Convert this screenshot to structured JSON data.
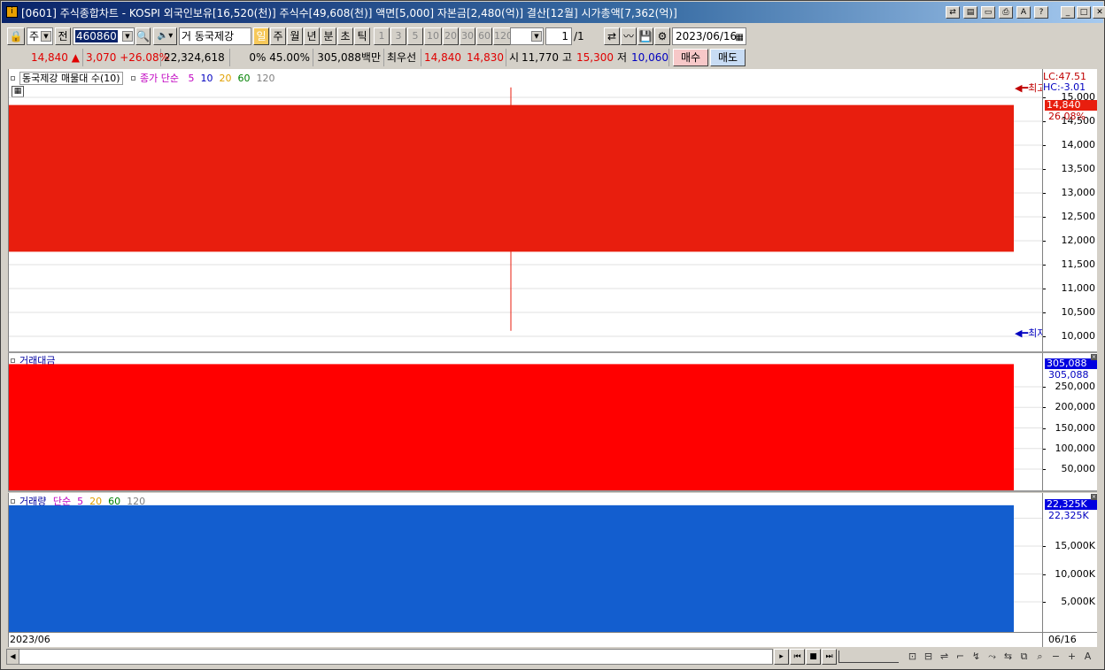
{
  "titlebar": {
    "icon": "app-icon",
    "text": "[0601] 주식종합차트 - KOSPI 외국인보유[16,520(천)] 주식수[49,608(천)] 액면[5,000] 자본금[2,480(억)] 결산[12월] 시가총액[7,362(억)]",
    "buttons": [
      "link-icon",
      "clipboard-icon",
      "window-icon",
      "print-icon",
      "font-icon",
      "help-icon",
      "minimize-icon",
      "maximize-icon",
      "close-icon"
    ],
    "button_glyphs": [
      "⇄",
      "▤",
      "▭",
      "⎙",
      "A",
      "?",
      "_",
      "□",
      "✕"
    ]
  },
  "toolbar": {
    "market": "주",
    "prev_label": "전",
    "code": "460860",
    "name_prefix": "거",
    "stock_name": "동국제강",
    "periods": [
      "일",
      "주",
      "월",
      "년",
      "분",
      "초",
      "틱"
    ],
    "minutes": [
      "1",
      "3",
      "5",
      "10",
      "20",
      "30",
      "60",
      "120"
    ],
    "page_current": "1",
    "page_total": "/1",
    "date": "2023/06/16"
  },
  "quote": {
    "price": "14,840",
    "change": "3,070",
    "change_pct": "+26.08%",
    "volume": "22,324,618",
    "ratio": "0% 45.00%",
    "amount": "305,088백만",
    "best_label": "최우선",
    "best_ask": "14,840",
    "best_bid": "14,830",
    "open_label": "시",
    "open": "11,770",
    "high_label": "고",
    "high": "15,300",
    "low_label": "저",
    "low": "10,060",
    "buy_label": "매수",
    "sell_label": "매도"
  },
  "price_panel": {
    "legend_title": "동국제강 매물대 수(10)",
    "ma_label": "종가 단순",
    "ma_periods": [
      "5",
      "10",
      "20",
      "60",
      "120"
    ],
    "ma_colors": [
      "#c000c0",
      "#0000c0",
      "#e0a000",
      "#008000",
      "#808080"
    ],
    "lc": "LC:47.51",
    "hc": "HC:-3.01",
    "current_price": "14,840",
    "current_pct": "26.08%",
    "high_marker": "최고",
    "low_marker": "최저",
    "ticks": [
      "15,000",
      "14,500",
      "14,000",
      "13,500",
      "13,000",
      "12,500",
      "12,000",
      "11,500",
      "11,000",
      "10,500",
      "10,000"
    ]
  },
  "amount_panel": {
    "legend_title": "거래대금",
    "current": "305,088",
    "current2": "305,088",
    "ticks": [
      "250,000",
      "200,000",
      "150,000",
      "100,000",
      "50,000"
    ]
  },
  "volume_panel": {
    "legend_title": "거래량",
    "ma_label": "단순",
    "ma_periods": [
      "5",
      "20",
      "60",
      "120"
    ],
    "ma_colors": [
      "#c000c0",
      "#e0a000",
      "#008000",
      "#808080"
    ],
    "current": "22,325K",
    "current2": "22,325K",
    "ticks": [
      "15,000K",
      "10,000K",
      "5,000K"
    ]
  },
  "chart_data": [
    {
      "type": "candlestick",
      "title": "동국제강",
      "x": [
        "2023/06/16"
      ],
      "open": [
        11770
      ],
      "high": [
        15300
      ],
      "low": [
        10060
      ],
      "close": [
        14840
      ],
      "ylim": [
        10000,
        15000
      ],
      "colors": {
        "up": "#e81e0e"
      }
    },
    {
      "type": "bar",
      "title": "거래대금",
      "categories": [
        "2023/06/16"
      ],
      "values": [
        305088
      ],
      "ylim": [
        0,
        305088
      ],
      "colors": {
        "bar": "#ff0000"
      }
    },
    {
      "type": "bar",
      "title": "거래량",
      "categories": [
        "2023/06/16"
      ],
      "values": [
        22325
      ],
      "ylim": [
        0,
        22325
      ],
      "colors": {
        "bar": "#135ecf"
      }
    }
  ],
  "footer": {
    "date_left": "2023/06",
    "date_right": "06/16"
  },
  "bottom_toolbar": {
    "nav_glyphs": [
      "▸",
      "⏮",
      "■",
      "⏭"
    ],
    "tool_glyphs": [
      "⊡",
      "⊟",
      "⇌",
      "⌐",
      "↯",
      "⤳",
      "⇆",
      "⧉",
      "⌕",
      "−",
      "+",
      "A"
    ]
  }
}
